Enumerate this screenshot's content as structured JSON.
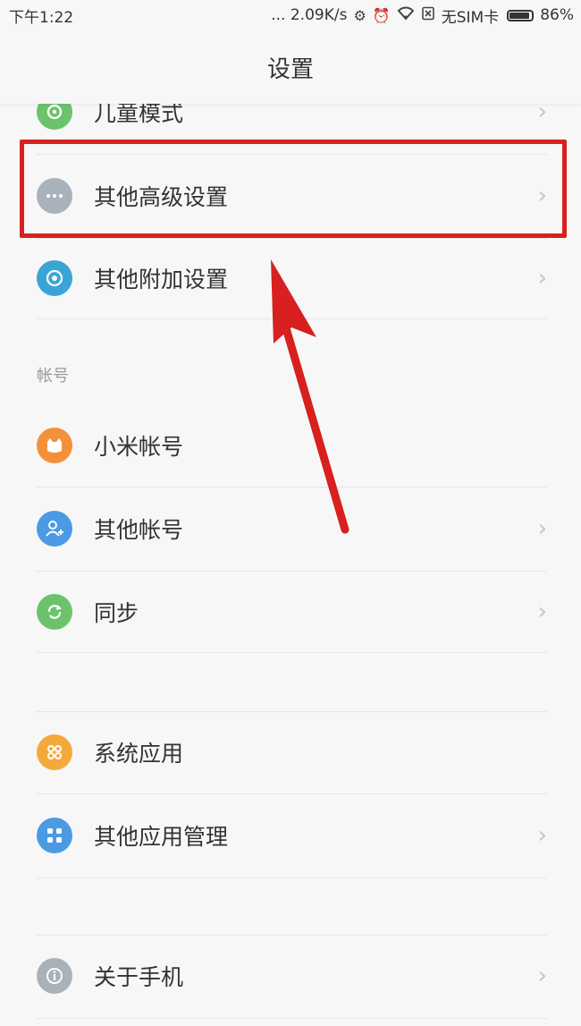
{
  "status_bar": {
    "time": "下午1:22",
    "network_speed": "... 2.09K/s",
    "sim_status": "无SIM卡",
    "battery": "86%",
    "icons": [
      "gear-icon",
      "alarm-icon",
      "wifi-icon",
      "sim-icon"
    ]
  },
  "header": {
    "title": "设置"
  },
  "settings": {
    "items": [
      {
        "label": "儿童模式",
        "icon": "child-mode-icon",
        "color": "#6cc36c",
        "has_chevron": true
      },
      {
        "label": "其他高级设置",
        "icon": "more-dots-icon",
        "color": "#a9b1bb",
        "has_chevron": true
      },
      {
        "label": "其他附加设置",
        "icon": "target-icon",
        "color": "#3ba4d6",
        "has_chevron": true
      }
    ]
  },
  "accounts": {
    "header": "帐号",
    "items": [
      {
        "label": "小米帐号",
        "icon": "mi-account-icon",
        "color": "#f2913a",
        "has_chevron": false
      },
      {
        "label": "其他帐号",
        "icon": "user-add-icon",
        "color": "#4a9be4",
        "has_chevron": true
      },
      {
        "label": "同步",
        "icon": "sync-icon",
        "color": "#6cc36c",
        "has_chevron": true
      }
    ]
  },
  "apps": {
    "items": [
      {
        "label": "系统应用",
        "icon": "system-apps-icon",
        "color": "#f3a93c",
        "has_chevron": false
      },
      {
        "label": "其他应用管理",
        "icon": "app-grid-icon",
        "color": "#4a9be4",
        "has_chevron": true
      }
    ]
  },
  "about": {
    "items": [
      {
        "label": "关于手机",
        "icon": "info-icon",
        "color": "#a9b1bb",
        "has_chevron": true
      }
    ]
  },
  "annotation": {
    "highlight_color": "#d7201f",
    "arrow_color": "#d7201f"
  }
}
